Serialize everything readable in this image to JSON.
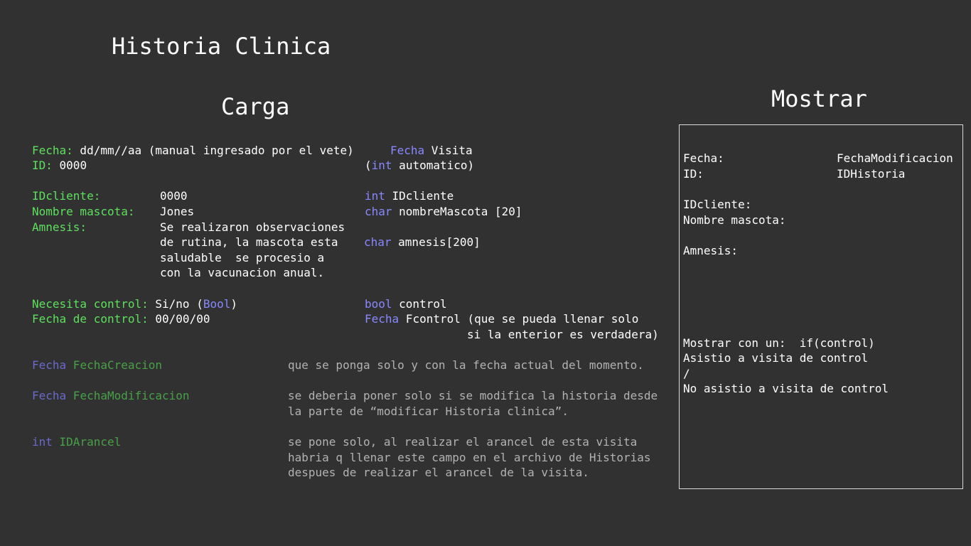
{
  "title": "Historia Clinica",
  "carga": {
    "heading": "Carga",
    "fecha_key": "Fecha:",
    "fecha_val": " dd/mm//aa (manual ingresado por el vete)",
    "fecha_type": "Fecha",
    "fecha_name": " Visita",
    "id_key": "ID:",
    "id_val": " 0000",
    "id_type_open": "(",
    "id_type": "int",
    "id_type_rest": " automatico)",
    "idcliente_key": "IDcliente:",
    "idcliente_val": "0000",
    "idcliente_type": "int",
    "idcliente_name": " IDcliente",
    "nombre_key": "Nombre mascota:",
    "nombre_val": "Jones",
    "nombre_type": "char",
    "nombre_name": " nombreMascota [20]",
    "amnesis_key": "Amnesis:",
    "amnesis_lines": [
      "Se realizaron observaciones",
      "de rutina, la mascota esta",
      "saludable  se procesio a",
      "con la vacunacion anual."
    ],
    "amnesis_type": "char",
    "amnesis_name": " amnesis[200]",
    "control_key": "Necesita control:",
    "control_val_a": " Si/no (",
    "control_val_b": "Bool",
    "control_val_c": ")",
    "control_type": "bool",
    "control_name": " control",
    "fcontrol_key": "Fecha de control:",
    "fcontrol_val": " 00/00/00",
    "fcontrol_type": "Fecha",
    "fcontrol_name": " Fcontrol (que se pueda llenar solo",
    "fcontrol_name2": "si la enterior es verdadera)",
    "creacion_type": "Fecha",
    "creacion_name": " FechaCreacion",
    "creacion_note": "que se ponga solo y con la fecha actual del momento.",
    "modif_type": "Fecha",
    "modif_name": " FechaModificacion",
    "modif_note_lines": [
      "se deberia poner solo si se modifica la historia desde",
      "la parte de “modificar Historia clinica”."
    ],
    "arancel_type": "int",
    "arancel_name": " IDArancel",
    "arancel_note_lines": [
      "se pone solo, al realizar el arancel de esta visita",
      "habria q llenar este campo en el archivo de Historias",
      "despues de realizar el arancel de la visita."
    ]
  },
  "mostrar": {
    "heading": "Mostrar",
    "fecha_label": "Fecha:",
    "fecha_value": "FechaModificacion",
    "id_label": "ID:",
    "id_value": "IDHistoria",
    "idcliente_label": "IDcliente:",
    "nombre_label": "Nombre mascota:",
    "amnesis_label": "Amnesis:",
    "control_lines": [
      "Mostrar con un:  if(control)",
      "Asistio a visita de control",
      "/",
      "No asistio a visita de control"
    ]
  }
}
